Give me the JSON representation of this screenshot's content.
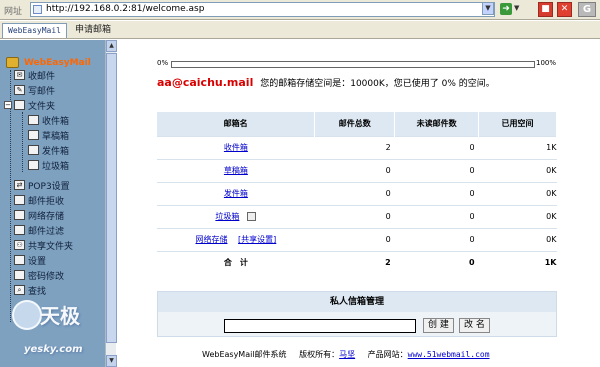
{
  "address_bar": {
    "label": "网址",
    "url": "http://192.168.0.2:81/welcome.asp"
  },
  "tabs": [
    {
      "label": "WebEasyMail"
    },
    {
      "label": "申请邮箱"
    }
  ],
  "sidebar": {
    "brand": "WebEasyMail",
    "items": [
      {
        "label": "收邮件"
      },
      {
        "label": "写邮件"
      },
      {
        "label": "文件夹"
      },
      {
        "label": "收件箱"
      },
      {
        "label": "草稿箱"
      },
      {
        "label": "发件箱"
      },
      {
        "label": "垃圾箱"
      },
      {
        "label": "POP3设置"
      },
      {
        "label": "邮件拒收"
      },
      {
        "label": "网络存储"
      },
      {
        "label": "邮件过滤"
      },
      {
        "label": "共享文件夹"
      },
      {
        "label": "设置"
      },
      {
        "label": "密码修改"
      },
      {
        "label": "查找"
      }
    ]
  },
  "usage": {
    "low": "0%",
    "high": "100%",
    "used_fraction": 0,
    "email": "aa@caichu.mail",
    "message": "您的邮箱存储空间是：10000K，您已使用了 0% 的空间。"
  },
  "mailbox_table": {
    "headers": [
      "邮箱名",
      "邮件总数",
      "未读邮件数",
      "已用空间"
    ],
    "rows": [
      {
        "name": "收件箱",
        "total": "2",
        "unread": "0",
        "size": "1K"
      },
      {
        "name": "草稿箱",
        "total": "0",
        "unread": "0",
        "size": "0K"
      },
      {
        "name": "发件箱",
        "total": "0",
        "unread": "0",
        "size": "0K"
      },
      {
        "name": "垃圾箱",
        "total": "0",
        "unread": "0",
        "size": "0K"
      },
      {
        "name": "网络存储",
        "extra": "[共享设置]",
        "total": "0",
        "unread": "0",
        "size": "0K"
      }
    ],
    "total_row": {
      "label": "合　计",
      "total": "2",
      "unread": "0",
      "size": "1K"
    }
  },
  "private_folder": {
    "title": "私人信箱管理",
    "input_value": "",
    "create_label": "创 建",
    "rename_label": "改 名"
  },
  "footer": {
    "system": "WebEasyMail邮件系统",
    "copyright_label": "版权所有：",
    "owner": "马坚",
    "site_label": "产品网站：",
    "site": "www.51webmail.com"
  },
  "watermark": {
    "brand": "天极",
    "site": "yesky.com"
  }
}
